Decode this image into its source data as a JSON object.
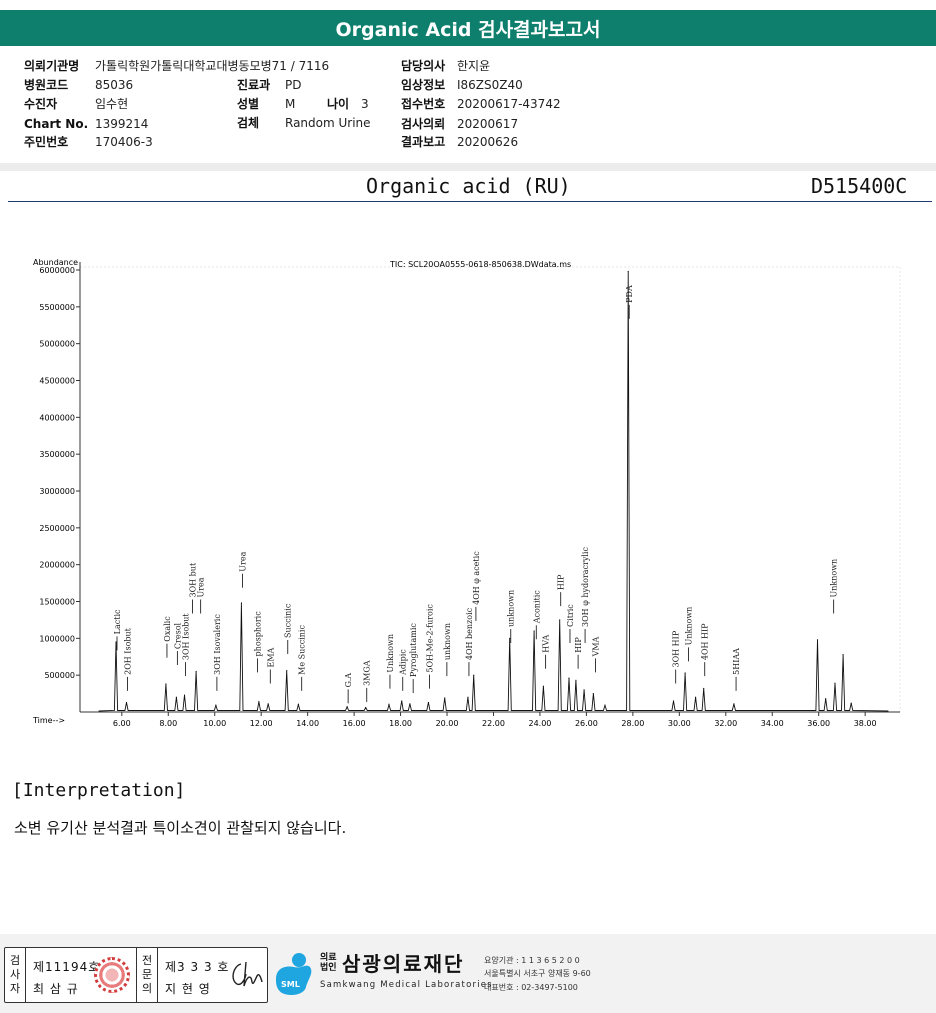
{
  "header": {
    "title": "Organic Acid 검사결과보고서"
  },
  "info": {
    "institution_label": "의뢰기관명",
    "institution": "가톨릭학원가톨릭대학교대병동모병71 / 7116",
    "code_label": "병원코드",
    "code": "85036",
    "collector_label": "수진자",
    "collector": "임수현",
    "chart_label": "Chart No.",
    "chart": "1399214",
    "resident_label": "주민번호",
    "resident": "170406-3",
    "dept_label": "진료과",
    "dept": "PD",
    "sex_label": "성별",
    "sex": "M",
    "age_label": "나이",
    "age": "3",
    "specimen_label": "검체",
    "specimen": "Random Urine",
    "doctor_label": "담당의사",
    "doctor": "한지윤",
    "clinical_label": "임상정보",
    "clinical": "I86ZS0Z40",
    "receipt_label": "접수번호",
    "receipt": "20200617-43742",
    "request_label": "검사의뢰",
    "request": "20200617",
    "report_label": "결과보고",
    "report": "20200626"
  },
  "report": {
    "name": "Organic acid (RU)",
    "code": "D515400C"
  },
  "chart_data": {
    "type": "line",
    "title": "TIC: SCL20OA0555-0618-850638.DWdata.ms",
    "ylabel": "Abundance",
    "xlabel": "Time-->",
    "xlim": [
      4.2,
      39.5
    ],
    "ylim": [
      0,
      6000000
    ],
    "x_ticks": [
      "6.00",
      "8.00",
      "10.00",
      "12.00",
      "14.00",
      "16.00",
      "18.00",
      "20.00",
      "22.00",
      "24.00",
      "26.00",
      "28.00",
      "30.00",
      "32.00",
      "34.00",
      "36.00",
      "38.00"
    ],
    "y_ticks": [
      "500000",
      "1000000",
      "1500000",
      "2000000",
      "2500000",
      "3000000",
      "3500000",
      "4000000",
      "4500000",
      "5000000",
      "5500000",
      "6000000"
    ],
    "peaks": [
      {
        "x": 5.75,
        "y": 950000
      },
      {
        "x": 6.2,
        "y": 130000
      },
      {
        "x": 7.9,
        "y": 380000
      },
      {
        "x": 8.35,
        "y": 200000
      },
      {
        "x": 8.7,
        "y": 230000
      },
      {
        "x": 9.2,
        "y": 550000
      },
      {
        "x": 10.05,
        "y": 90000
      },
      {
        "x": 11.15,
        "y": 1480000
      },
      {
        "x": 11.9,
        "y": 140000
      },
      {
        "x": 12.3,
        "y": 110000
      },
      {
        "x": 13.1,
        "y": 560000
      },
      {
        "x": 13.6,
        "y": 100000
      },
      {
        "x": 15.7,
        "y": 70000
      },
      {
        "x": 16.5,
        "y": 60000
      },
      {
        "x": 17.5,
        "y": 100000
      },
      {
        "x": 18.05,
        "y": 150000
      },
      {
        "x": 18.4,
        "y": 110000
      },
      {
        "x": 19.2,
        "y": 130000
      },
      {
        "x": 19.9,
        "y": 190000
      },
      {
        "x": 20.9,
        "y": 200000
      },
      {
        "x": 21.15,
        "y": 500000
      },
      {
        "x": 22.7,
        "y": 1000000
      },
      {
        "x": 23.75,
        "y": 1100000
      },
      {
        "x": 24.15,
        "y": 350000
      },
      {
        "x": 24.85,
        "y": 1250000
      },
      {
        "x": 25.25,
        "y": 460000
      },
      {
        "x": 25.55,
        "y": 430000
      },
      {
        "x": 25.9,
        "y": 300000
      },
      {
        "x": 26.3,
        "y": 250000
      },
      {
        "x": 26.8,
        "y": 90000
      },
      {
        "x": 27.8,
        "y": 5980000
      },
      {
        "x": 29.75,
        "y": 150000
      },
      {
        "x": 30.25,
        "y": 530000
      },
      {
        "x": 30.7,
        "y": 200000
      },
      {
        "x": 31.05,
        "y": 320000
      },
      {
        "x": 32.35,
        "y": 110000
      },
      {
        "x": 35.95,
        "y": 980000
      },
      {
        "x": 36.3,
        "y": 180000
      },
      {
        "x": 36.7,
        "y": 390000
      },
      {
        "x": 37.05,
        "y": 780000
      },
      {
        "x": 37.4,
        "y": 120000
      }
    ],
    "annotations": [
      {
        "text": "Lactic",
        "x": 5.75,
        "y": 1000000
      },
      {
        "text": "2OH Isobut",
        "x": 6.2,
        "y": 450000
      },
      {
        "text": "Oxalic",
        "x": 7.9,
        "y": 900000
      },
      {
        "text": "Cresol",
        "x": 8.35,
        "y": 800000
      },
      {
        "text": "3OH Isobut",
        "x": 8.7,
        "y": 650000
      },
      {
        "text": "3OH but",
        "x": 9.0,
        "y": 1500000
      },
      {
        "text": "Urea",
        "x": 9.35,
        "y": 1500000
      },
      {
        "text": "3OH Isovaleric",
        "x": 10.05,
        "y": 450000
      },
      {
        "text": "Urea",
        "x": 11.15,
        "y": 1850000
      },
      {
        "text": "phosphoric",
        "x": 11.8,
        "y": 700000
      },
      {
        "text": "EMA",
        "x": 12.35,
        "y": 550000
      },
      {
        "text": "Succinic",
        "x": 13.1,
        "y": 950000
      },
      {
        "text": "Me Succinic",
        "x": 13.7,
        "y": 450000
      },
      {
        "text": "G.A",
        "x": 15.7,
        "y": 280000
      },
      {
        "text": "3MGA",
        "x": 16.5,
        "y": 300000
      },
      {
        "text": "Unknown",
        "x": 17.5,
        "y": 480000
      },
      {
        "text": "Adipic",
        "x": 18.05,
        "y": 450000
      },
      {
        "text": "Pyroglutamic",
        "x": 18.5,
        "y": 420000
      },
      {
        "text": "5OH-Me-2-furoic",
        "x": 19.2,
        "y": 480000
      },
      {
        "text": "unknown",
        "x": 19.95,
        "y": 650000
      },
      {
        "text": "4OH benzoic",
        "x": 20.9,
        "y": 650000
      },
      {
        "text": "4OH φ acetic",
        "x": 21.2,
        "y": 1400000
      },
      {
        "text": "unknown",
        "x": 22.7,
        "y": 1100000
      },
      {
        "text": "Aconitic",
        "x": 23.8,
        "y": 1150000
      },
      {
        "text": "HVA",
        "x": 24.2,
        "y": 750000
      },
      {
        "text": "HIP",
        "x": 24.85,
        "y": 1600000
      },
      {
        "text": "Citric",
        "x": 25.25,
        "y": 1100000
      },
      {
        "text": "HIP",
        "x": 25.6,
        "y": 750000
      },
      {
        "text": "3OH φ hydoracrylic",
        "x": 25.9,
        "y": 1100000
      },
      {
        "text": "VMA",
        "x": 26.35,
        "y": 700000
      },
      {
        "text": "PDA",
        "x": 27.8,
        "y": 5500000
      },
      {
        "text": "3OH HIP",
        "x": 29.8,
        "y": 550000
      },
      {
        "text": "Unknown",
        "x": 30.35,
        "y": 850000
      },
      {
        "text": "4OH HIP",
        "x": 31.05,
        "y": 650000
      },
      {
        "text": "5HIAA",
        "x": 32.4,
        "y": 450000
      },
      {
        "text": "Unknown",
        "x": 36.6,
        "y": 1500000
      }
    ]
  },
  "interpretation": {
    "title": "[Interpretation]",
    "text": "소변 유기산 분석결과 특이소견이 관찰되지 않습니다."
  },
  "footer": {
    "sign1_label": "검사자",
    "sign1_no": "제11194호",
    "sign1_name": "최 삼 규",
    "sign2_label": "전문의",
    "sign2_no": "제3 3 3 호",
    "sign2_name": "지 현 영",
    "org_prefix": "의료법인",
    "org_name": "삼광의료재단",
    "org_en": "Samkwang Medical Laboratories",
    "org_logo_text": "SML",
    "org_code": "요양기관 : 1 1 3 6 5 2 0 0",
    "org_address": "서울특별시 서초구 양재동 9-60",
    "org_phone": "대표번호 : 02-3497-5100",
    "colors": {
      "brand": "#0d7f6c",
      "logo": "#1fa6e0",
      "stamp": "#d23b3b"
    }
  }
}
